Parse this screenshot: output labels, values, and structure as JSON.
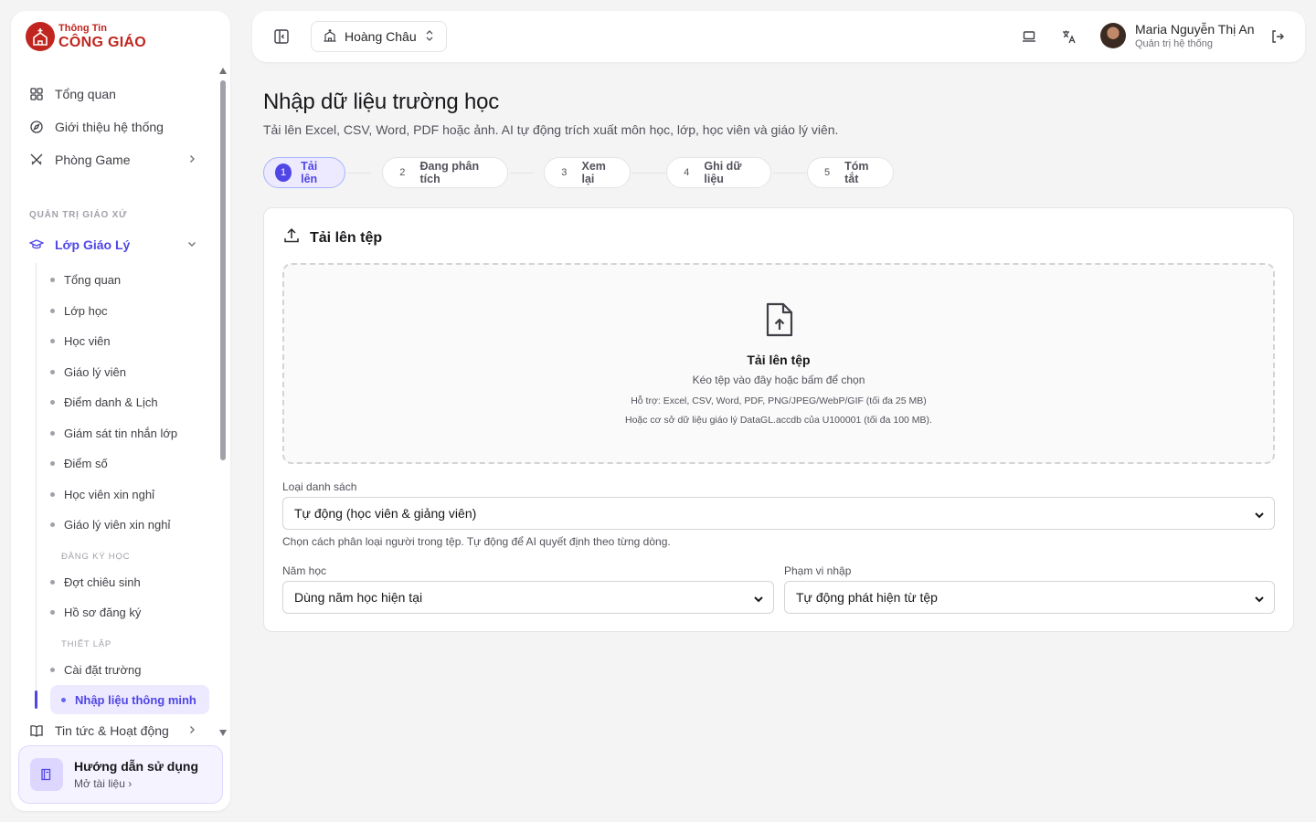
{
  "app": {
    "logo_top": "Thông Tin",
    "logo_bottom": "CÔNG GIÁO",
    "brand_color": "#c0261f",
    "accent_color": "#4f46e5"
  },
  "sidebar": {
    "items_top": [
      {
        "label": "Tổng quan",
        "icon": "grid-icon"
      },
      {
        "label": "Giới thiệu hệ thống",
        "icon": "compass-icon"
      },
      {
        "label": "Phòng Game",
        "icon": "swords-icon"
      }
    ],
    "section_parish": "QUẢN TRỊ GIÁO XỨ",
    "catechism": {
      "label": "Lớp Giáo Lý",
      "icon": "graduation-cap-icon"
    },
    "catechism_items": [
      "Tổng quan",
      "Lớp học",
      "Học viên",
      "Giáo lý viên",
      "Điểm danh & Lịch",
      "Giám sát tin nhắn lớp",
      "Điểm số",
      "Học viên xin nghỉ",
      "Giáo lý viên xin nghỉ"
    ],
    "section_enroll": "ĐĂNG KÝ HỌC",
    "enroll_items": [
      "Đợt chiêu sinh",
      "Hồ sơ đăng ký"
    ],
    "section_setup": "THIẾT LẬP",
    "setup_items": [
      "Cài đặt trường"
    ],
    "active_item": "Nhập liệu thông minh",
    "news": {
      "label": "Tin tức & Hoạt động",
      "icon": "book-open-icon"
    },
    "guide": {
      "title": "Hướng dẫn sử dụng",
      "link": "Mở tài liệu"
    }
  },
  "header": {
    "parish": "Hoàng Châu",
    "user_name": "Maria Nguyễn Thị An",
    "user_role": "Quản trị hệ thống"
  },
  "main": {
    "title": "Nhập dữ liệu trường học",
    "subtitle": "Tải lên Excel, CSV, Word, PDF hoặc ảnh. AI tự động trích xuất môn học, lớp, học viên và giáo lý viên.",
    "steps": [
      {
        "num": "1",
        "label": "Tải lên"
      },
      {
        "num": "2",
        "label": "Đang phân tích"
      },
      {
        "num": "3",
        "label": "Xem lại"
      },
      {
        "num": "4",
        "label": "Ghi dữ liệu"
      },
      {
        "num": "5",
        "label": "Tóm tắt"
      }
    ],
    "active_step": 1,
    "card_title": "Tải lên tệp",
    "dropzone": {
      "title": "Tải lên tệp",
      "desc": "Kéo tệp vào đây hoặc bấm để chọn",
      "support": "Hỗ trợ: Excel, CSV, Word, PDF, PNG/JPEG/WebP/GIF (tối đa 25 MB)",
      "db": "Hoặc cơ sở dữ liệu giáo lý DataGL.accdb của U100001 (tối đa 100 MB)."
    },
    "list_type_label": "Loại danh sách",
    "list_type_value": "Tự động (học viên & giảng viên)",
    "list_type_help": "Chọn cách phân loại người trong tệp. Tự động để AI quyết định theo từng dòng.",
    "year_label": "Năm học",
    "year_value": "Dùng năm học hiện tại",
    "scope_label": "Phạm vi nhập",
    "scope_value": "Tự động phát hiện từ tệp"
  }
}
